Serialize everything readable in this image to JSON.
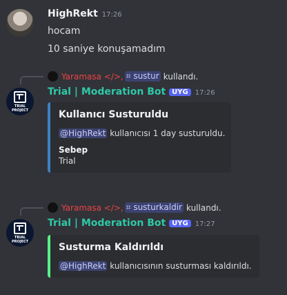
{
  "msg1": {
    "username": "HighRekt",
    "time": "17:26",
    "lines": [
      "hocam",
      "10 saniye konuşamadım"
    ]
  },
  "bot1": {
    "context": {
      "user": "Yaramasa </>,",
      "command": "⌗ sustur",
      "suffix": "kullandı."
    },
    "bot_name": "Trial | Moderation Bot",
    "tag": "UYG",
    "time": "17:26",
    "avatar_text": "TRIAL PROJECT",
    "embed": {
      "title": "Kullanıcı Susturuldu",
      "mention": "@HighRekt",
      "desc_rest": " kullanıcısı 1 day susturuldu.",
      "field_name": "Sebep",
      "field_value": "Trial",
      "accent": "#3b82c4"
    }
  },
  "bot2": {
    "context": {
      "user": "Yaramasa </>,",
      "command": "⌗ susturkaldir",
      "suffix": "kullandı."
    },
    "bot_name": "Trial | Moderation Bot",
    "tag": "UYG",
    "time": "17:27",
    "avatar_text": "TRIAL PROJECT",
    "embed": {
      "title": "Susturma Kaldırıldı",
      "mention": "@HighRekt",
      "desc_rest": " kullanıcısının susturması kaldırıldı.",
      "accent": "#57f287"
    }
  }
}
